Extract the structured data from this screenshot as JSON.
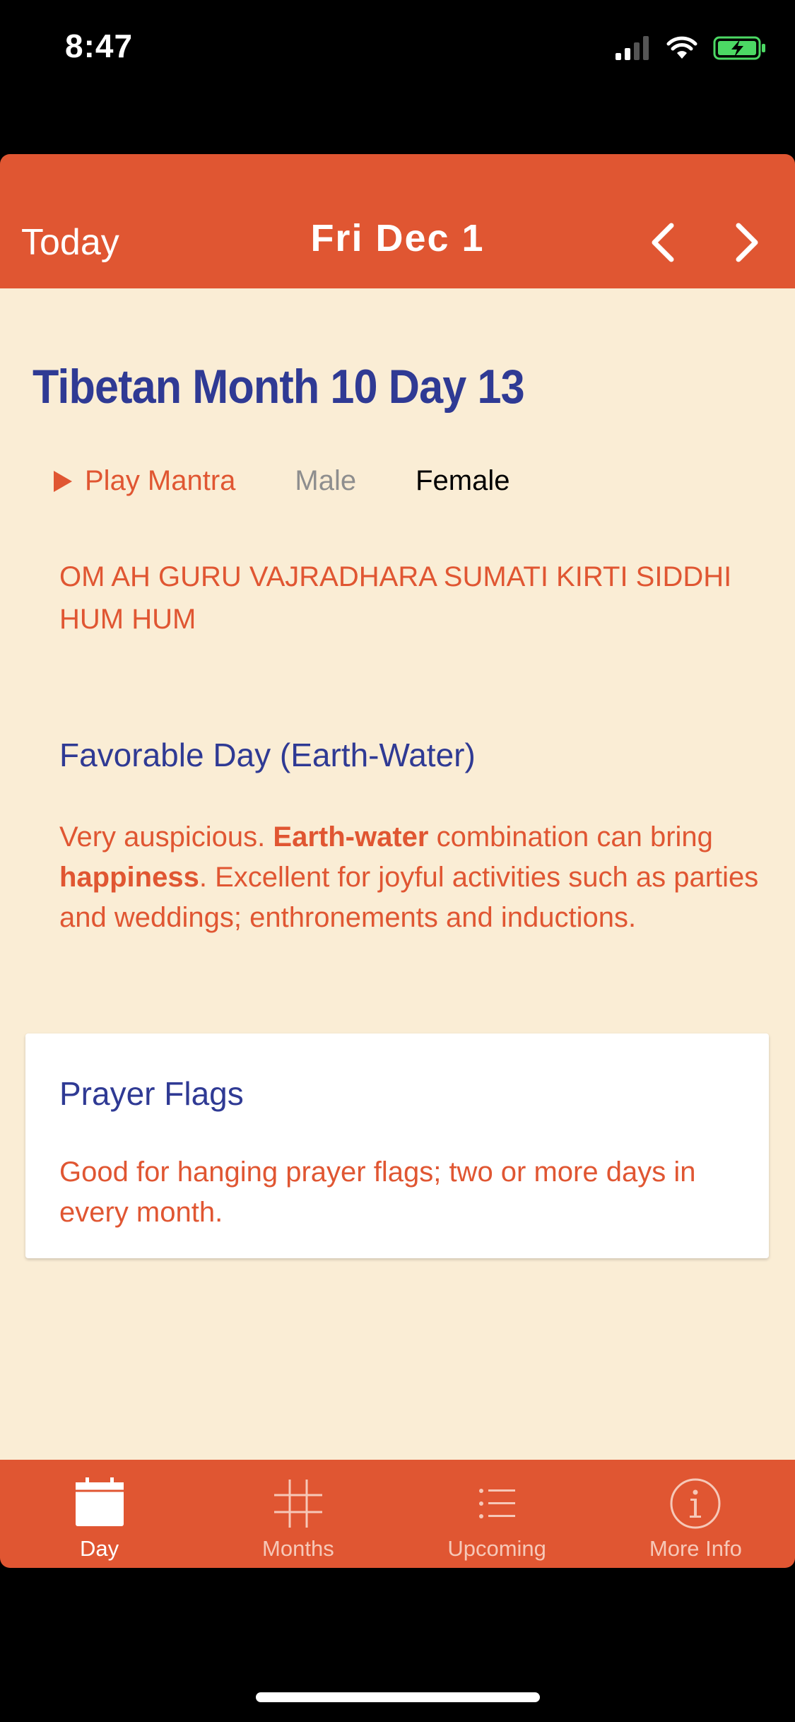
{
  "status": {
    "time": "8:47"
  },
  "header": {
    "today_label": "Today",
    "date": "Fri Dec 1",
    "prev_icon": "chevron-left-icon",
    "next_icon": "chevron-right-icon"
  },
  "day": {
    "title": "Tibetan Month 10 Day 13",
    "play_label": "Play Mantra",
    "voice_male": "Male",
    "voice_female": "Female",
    "mantra": "OM AH GURU VAJRADHARA SUMATI KIRTI SIDDHI HUM HUM",
    "section_title": "Favorable Day (Earth-Water)",
    "desc": {
      "p1": "Very auspicious. ",
      "b1": "Earth-water",
      "p2": " combination can bring ",
      "b2": "happiness",
      "p3": ". Excellent for joyful activities such as parties and weddings; enthronements and inductions."
    }
  },
  "card": {
    "title": "Prayer Flags",
    "desc": "Good for hanging prayer flags; two or more days in every month."
  },
  "tabs": [
    {
      "label": "Day",
      "icon": "calendar-icon"
    },
    {
      "label": "Months",
      "icon": "grid-icon"
    },
    {
      "label": "Upcoming",
      "icon": "list-icon"
    },
    {
      "label": "More Info",
      "icon": "info-icon"
    }
  ],
  "colors": {
    "accent": "#E05632",
    "title_blue": "#2F3A94",
    "background": "#FAEDD5"
  }
}
